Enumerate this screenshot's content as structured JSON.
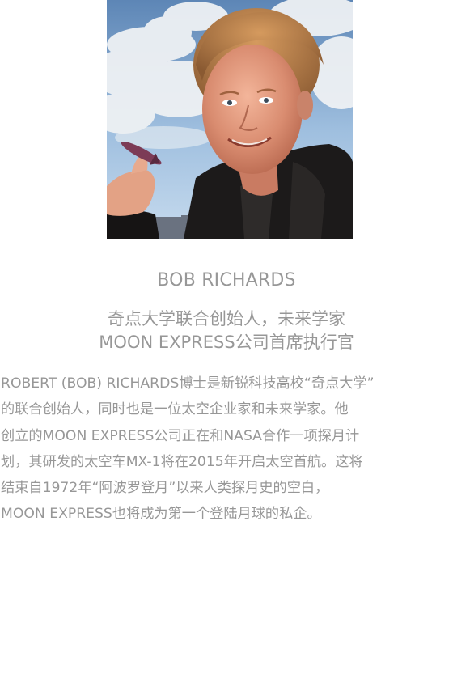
{
  "profile": {
    "name": "BOB RICHARDS",
    "role_lines": [
      "奇点大学联合创始人，未来学家",
      "MOON EXPRESS公司首席执行官"
    ],
    "bio_lines": [
      "ROBERT (BOB) RICHARDS博士是新锐科技高校“奇点大学”",
      "的联合创始人，同时也是一位太空企业家和未来学家。他",
      "创立的MOON EXPRESS公司正在和NASA合作一项探月计",
      "划，其研发的太空车MX-1将在2015年开启太空首航。这将",
      "结束自1972年“阿波罗登月”以来人类探月史的空白，",
      "MOON EXPRESS也将成为第一个登陆月球的私企。"
    ]
  },
  "colors": {
    "text": "#979797",
    "background": "#ffffff",
    "sky_top": "#5d86b6",
    "sky_bottom": "#c7dbee"
  }
}
